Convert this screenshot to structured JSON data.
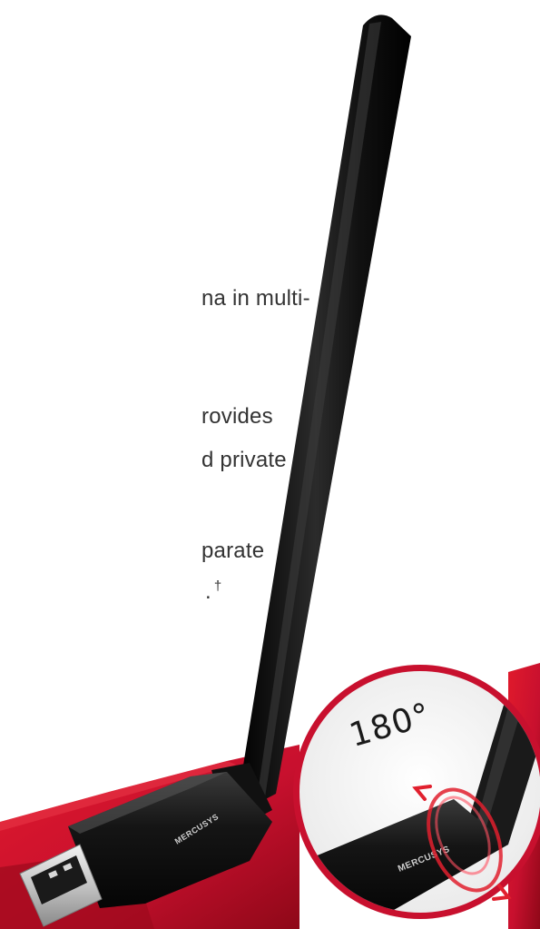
{
  "feature_text": {
    "line1": "na in multi-",
    "line2": "rovides",
    "line3": "d private",
    "line4": "parate",
    "line5_end": ".",
    "dagger": "†"
  },
  "badge": {
    "rotation_label": "180°"
  },
  "product": {
    "brand": "MERCUSYS"
  },
  "colors": {
    "accent_red": "#c8102e",
    "antenna_black": "#141414",
    "text_gray": "#333333"
  },
  "icons": [
    "usb-connector-icon",
    "rotation-arrows-icon"
  ]
}
